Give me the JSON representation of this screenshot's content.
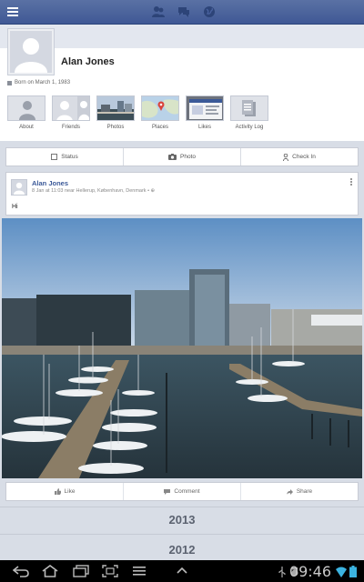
{
  "topbar": {
    "icons": [
      "menu-icon",
      "friend-requests-icon",
      "messages-icon",
      "notifications-globe-icon"
    ]
  },
  "profile": {
    "name": "Alan Jones",
    "born": "Born on March 1, 1983",
    "tiles": [
      {
        "label": "About",
        "icon": "person-icon"
      },
      {
        "label": "Friends",
        "icon": "friends-icon"
      },
      {
        "label": "Photos",
        "icon": "photos-thumbnail"
      },
      {
        "label": "Places",
        "icon": "map-icon"
      },
      {
        "label": "Likes",
        "icon": "likes-thumbnail"
      },
      {
        "label": "Activity Log",
        "icon": "activity-log-icon"
      }
    ]
  },
  "actions": {
    "status": "Status",
    "photo": "Photo",
    "checkin": "Check In"
  },
  "post": {
    "author": "Alan Jones",
    "meta": "8 Jan at 11:03 near Hellerup, København, Denmark • ⊕",
    "text": "Hi"
  },
  "post_actions": {
    "like": "Like",
    "comment": "Comment",
    "share": "Share"
  },
  "timeline": {
    "years": [
      "2013",
      "2012"
    ]
  },
  "system_bar": {
    "time": "09:46",
    "colors": {
      "clock": "#c9c9c9",
      "wifi": "#3bb3e0",
      "battery": "#3bb3e0"
    }
  },
  "colors": {
    "facebook_blue": "#3b5998",
    "topbar": "#4a63a0",
    "background": "#d8dde6"
  }
}
